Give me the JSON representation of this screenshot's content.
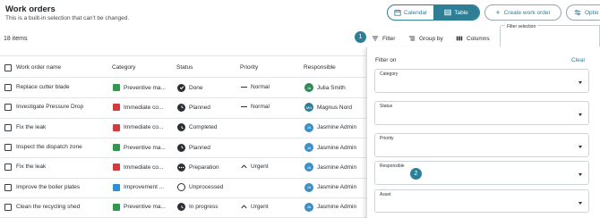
{
  "header": {
    "title": "Work orders",
    "subtitle": "This is a built-in selection that can't be changed."
  },
  "view_toggle": {
    "calendar_label": "Calendar",
    "table_label": "Table",
    "active": "Table"
  },
  "create_label": "Create work order",
  "options_label": "Optio",
  "item_count": "18 items",
  "toolbar": {
    "step_badge": "1",
    "filter_label": "Filter",
    "group_label": "Group by",
    "columns_label": "Columns"
  },
  "table": {
    "headers": [
      "Work order name",
      "Category",
      "Status",
      "Priority",
      "Responsible"
    ],
    "rows": [
      {
        "name": "Replace cutter blade",
        "category": "Preventive ma...",
        "cat_color": "#2e9b4a",
        "status": "Done",
        "status_icon": "check-circle-icon",
        "priority": "Normal",
        "priority_icon": "dash-icon",
        "initials": "JA",
        "avatar_color": "#2e8b57",
        "person": "Julia Smith"
      },
      {
        "name": "Investigate Pressure Drop",
        "category": "Immediate co...",
        "cat_color": "#d63b3b",
        "status": "Planned",
        "status_icon": "clock-icon",
        "priority": "Normal",
        "priority_icon": "dash-icon",
        "initials": "MN",
        "avatar_color": "#2e7f96",
        "person": "Magnus Nord"
      },
      {
        "name": "Fix the leak",
        "category": "Immediate co...",
        "cat_color": "#d63b3b",
        "status": "Completed",
        "status_icon": "clock-icon",
        "priority": "",
        "priority_icon": "",
        "initials": "JA",
        "avatar_color": "#3b8fc7",
        "person": "Jasmine Admin"
      },
      {
        "name": "Inspect the dispatch zone",
        "category": "Preventive ma...",
        "cat_color": "#2e9b4a",
        "status": "Planned",
        "status_icon": "clock-icon",
        "priority": "",
        "priority_icon": "",
        "initials": "JA",
        "avatar_color": "#3b8fc7",
        "person": "Jasmine Admin"
      },
      {
        "name": "Fix the leak",
        "category": "Immediate co...",
        "cat_color": "#d63b3b",
        "status": "Preparation",
        "status_icon": "dots-icon",
        "priority": "Urgent",
        "priority_icon": "chevron-up-icon",
        "initials": "JA",
        "avatar_color": "#3b8fc7",
        "person": "Jasmine Admin"
      },
      {
        "name": "Improve the boiler plates",
        "category": "Improvement ...",
        "cat_color": "#2a8fd4",
        "status": "Unprocessed",
        "status_icon": "empty-circle-icon",
        "priority": "",
        "priority_icon": "",
        "initials": "JA",
        "avatar_color": "#3b8fc7",
        "person": "Jasmine Admin"
      },
      {
        "name": "Clean the recycling shed",
        "category": "Preventive ma...",
        "cat_color": "#2e9b4a",
        "status": "In progress",
        "status_icon": "clock-icon",
        "priority": "Urgent",
        "priority_icon": "chevron-up-icon",
        "initials": "JA",
        "avatar_color": "#3b8fc7",
        "person": "Jasmine Admin"
      }
    ]
  },
  "filter_panel": {
    "selection_label": "Filter selection",
    "filter_on": "Filter on",
    "clear": "Clear",
    "fields": [
      "Category",
      "Status",
      "Priority",
      "Responsible",
      "Asset"
    ],
    "step_badge": "2"
  }
}
